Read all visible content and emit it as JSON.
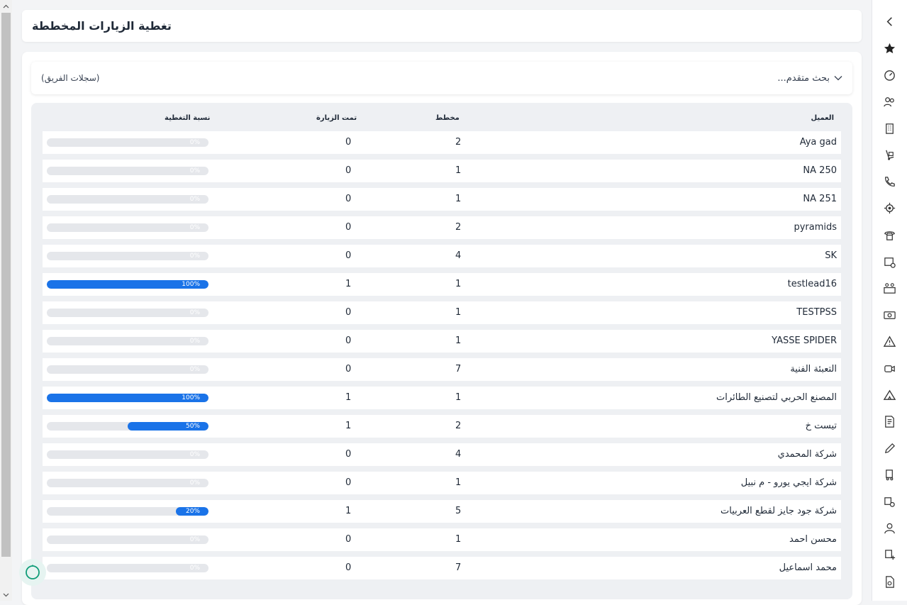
{
  "page": {
    "title": "تغطية الزيارات المخططة"
  },
  "search": {
    "advanced_label": "بحث متقدم...",
    "team_label": "(سجلات الفريق)"
  },
  "table": {
    "headers": {
      "client": "العميل",
      "planned": "مخطط",
      "visited": "تمت الزيارة",
      "coverage": "نسبة التغطية"
    },
    "rows": [
      {
        "client": "Aya gad",
        "planned": "2",
        "visited": "0",
        "coverage": "0%",
        "pct": 0
      },
      {
        "client": "NA 250",
        "planned": "1",
        "visited": "0",
        "coverage": "0%",
        "pct": 0
      },
      {
        "client": "NA 251",
        "planned": "1",
        "visited": "0",
        "coverage": "0%",
        "pct": 0
      },
      {
        "client": "pyramids",
        "planned": "2",
        "visited": "0",
        "coverage": "0%",
        "pct": 0
      },
      {
        "client": "SK",
        "planned": "4",
        "visited": "0",
        "coverage": "0%",
        "pct": 0
      },
      {
        "client": "testlead16",
        "planned": "1",
        "visited": "1",
        "coverage": "100%",
        "pct": 100
      },
      {
        "client": "TESTPSS",
        "planned": "1",
        "visited": "0",
        "coverage": "0%",
        "pct": 0
      },
      {
        "client": "YASSE SPIDER",
        "planned": "1",
        "visited": "0",
        "coverage": "0%",
        "pct": 0
      },
      {
        "client": "التعبئة الفنية",
        "planned": "7",
        "visited": "0",
        "coverage": "0%",
        "pct": 0
      },
      {
        "client": "المصنع الحربي لتصنيع الطائرات",
        "planned": "1",
        "visited": "1",
        "coverage": "100%",
        "pct": 100
      },
      {
        "client": "تيست خ",
        "planned": "2",
        "visited": "1",
        "coverage": "50%",
        "pct": 50
      },
      {
        "client": "شركة المحمدي",
        "planned": "4",
        "visited": "0",
        "coverage": "0%",
        "pct": 0
      },
      {
        "client": "شركة ايجي يورو  - م نبيل",
        "planned": "1",
        "visited": "0",
        "coverage": "0%",
        "pct": 0
      },
      {
        "client": "شركة جود جايز لقطع العربيات",
        "planned": "5",
        "visited": "1",
        "coverage": "20%",
        "pct": 20
      },
      {
        "client": "محسن احمد",
        "planned": "1",
        "visited": "0",
        "coverage": "0%",
        "pct": 0
      },
      {
        "client": "محمد اسماعيل",
        "planned": "7",
        "visited": "0",
        "coverage": "0%",
        "pct": 0
      }
    ]
  },
  "colors": {
    "accent": "#1a73e8",
    "bar_track": "#e5e7eb",
    "fab_ring": "#0f9d78"
  },
  "sidebar_icons": [
    "collapse-chevron-icon",
    "star-icon",
    "speedometer-icon",
    "users-icon",
    "building-icon",
    "hand-truck-icon",
    "phone-call-icon",
    "location-target-icon",
    "telephone-icon",
    "box-settings-icon",
    "team-icon",
    "money-icon",
    "warning-icon",
    "video-call-icon",
    "tent-icon",
    "invoice-icon",
    "pen-icon",
    "delivery-truck-icon",
    "truck-gear-icon",
    "user-icon",
    "truck-plus-icon",
    "document-icon"
  ]
}
